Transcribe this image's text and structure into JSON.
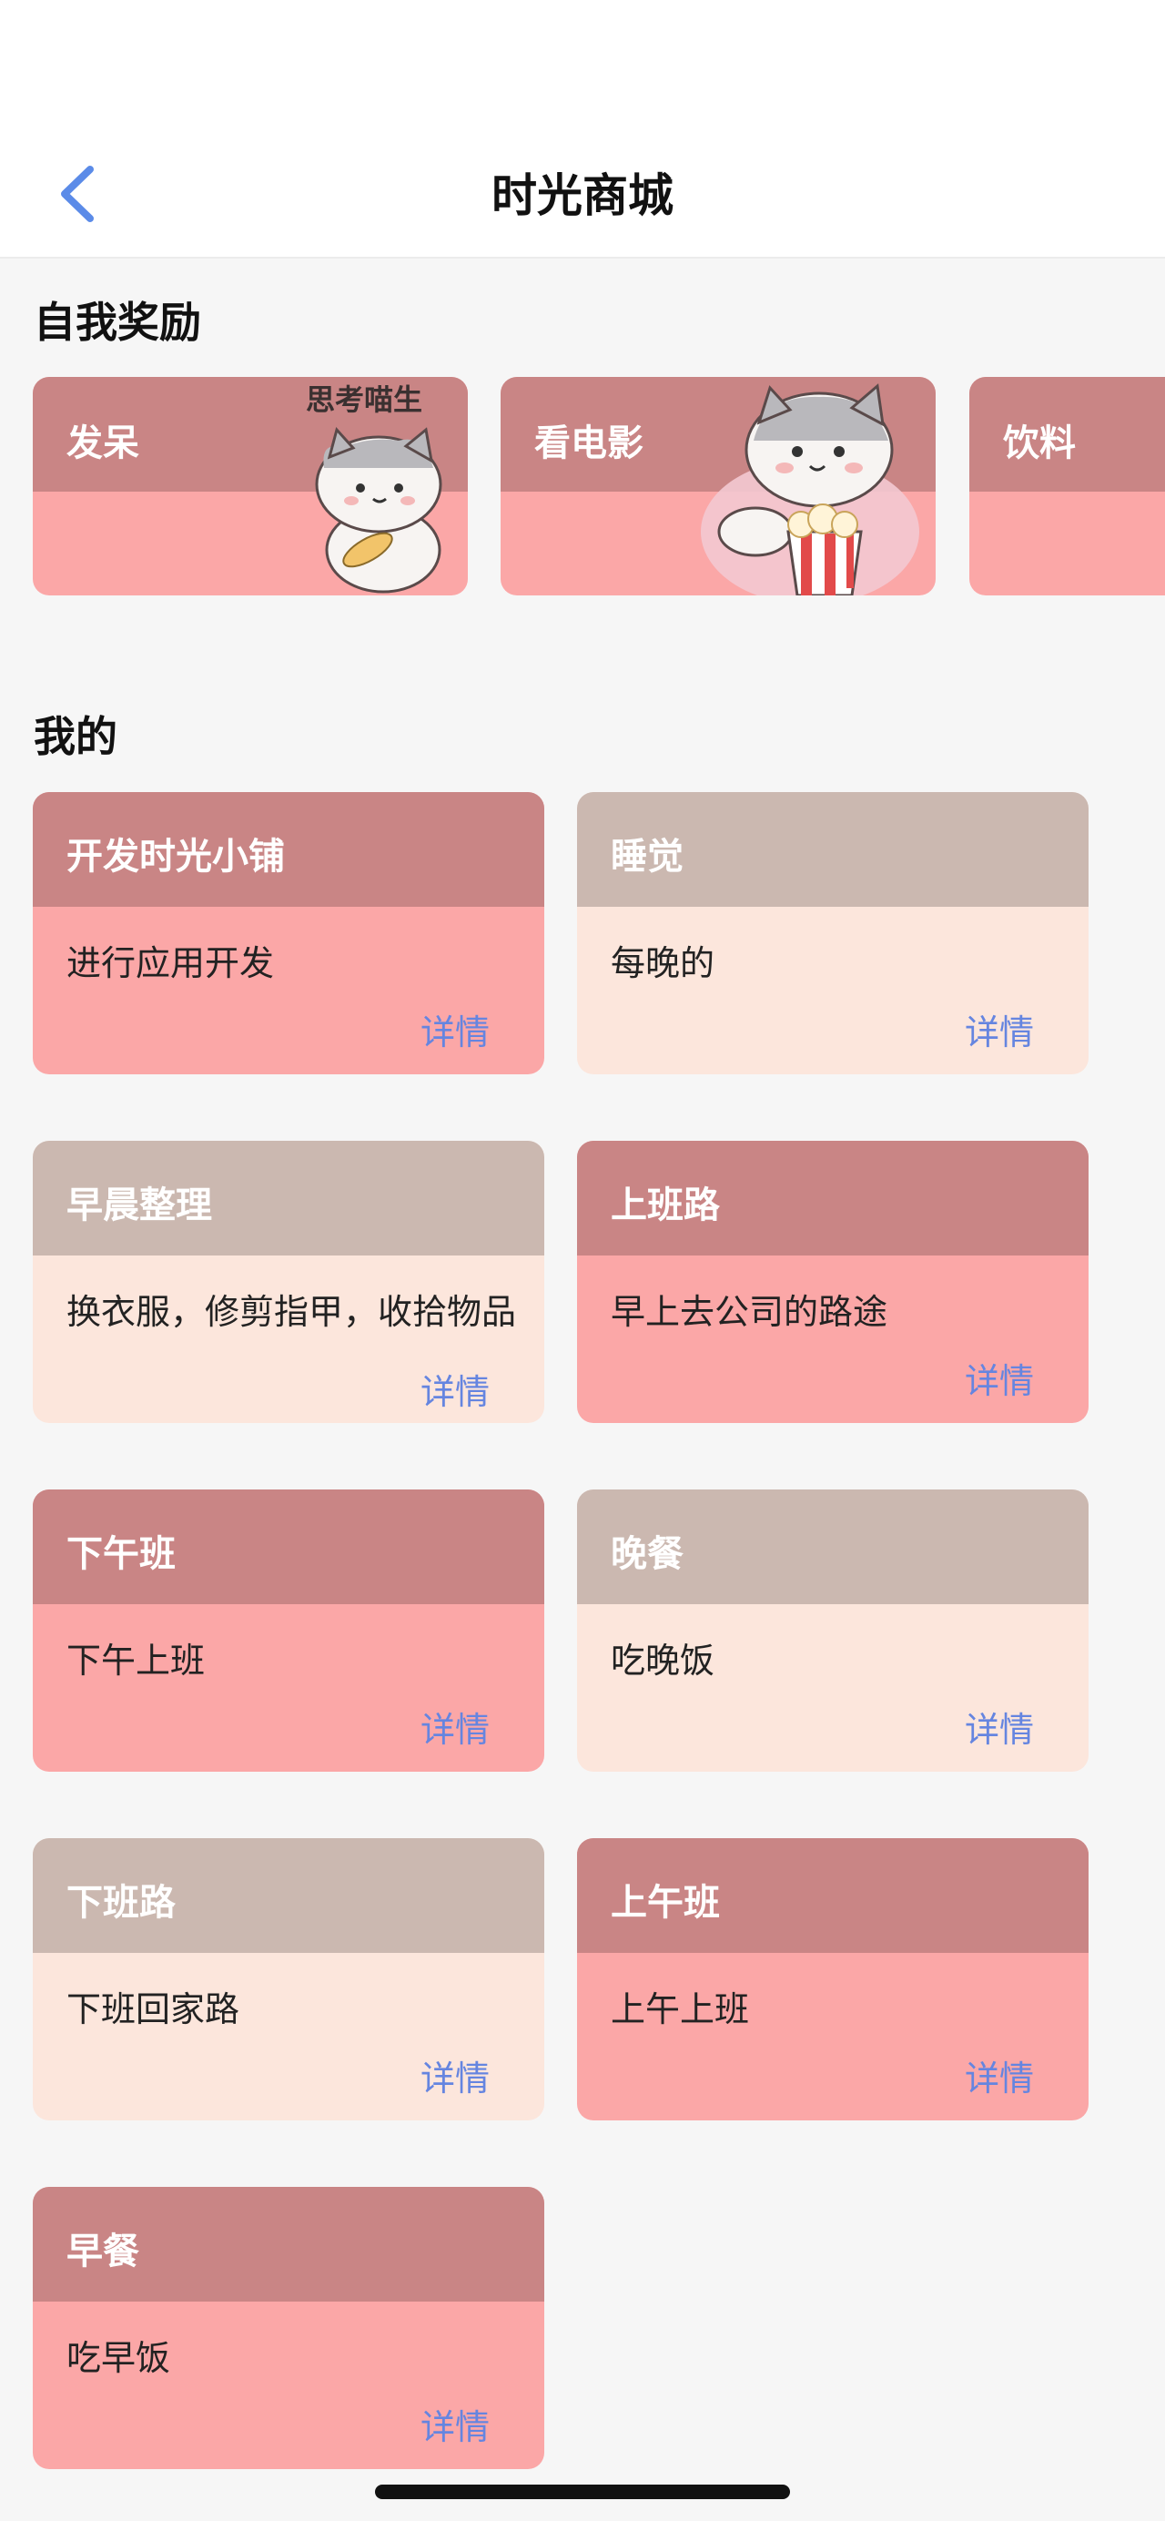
{
  "header": {
    "title": "时光商城",
    "back_icon": "chevron-left-icon",
    "accent": "#5b8be8"
  },
  "sections": {
    "rewards_title": "自我奖励",
    "mine_title": "我的"
  },
  "rewards": [
    {
      "label": "发呆",
      "sticker_text": "思考喵生"
    },
    {
      "label": "看电影"
    },
    {
      "label": "饮料"
    }
  ],
  "cards": [
    {
      "title": "开发时光小铺",
      "desc": "进行应用开发",
      "detail": "详情",
      "theme": "rose"
    },
    {
      "title": "睡觉",
      "desc": "每晚的",
      "detail": "详情",
      "theme": "taupe"
    },
    {
      "title": "早晨整理",
      "desc": "换衣服，修剪指甲，收拾物品等",
      "detail": "详情",
      "theme": "taupe"
    },
    {
      "title": "上班路",
      "desc": "早上去公司的路途",
      "detail": "详情",
      "theme": "rose"
    },
    {
      "title": "下午班",
      "desc": "下午上班",
      "detail": "详情",
      "theme": "rose"
    },
    {
      "title": "晚餐",
      "desc": "吃晚饭",
      "detail": "详情",
      "theme": "taupe"
    },
    {
      "title": "下班路",
      "desc": "下班回家路",
      "detail": "详情",
      "theme": "taupe"
    },
    {
      "title": "上午班",
      "desc": "上午上班",
      "detail": "详情",
      "theme": "rose"
    },
    {
      "title": "早餐",
      "desc": "吃早饭",
      "detail": "详情",
      "theme": "rose"
    }
  ],
  "colors": {
    "rose_header": "#c98585",
    "rose_body": "#fba7a7",
    "taupe_header": "#cbb8b0",
    "taupe_body": "#fce6dc",
    "link": "#6585e0"
  }
}
